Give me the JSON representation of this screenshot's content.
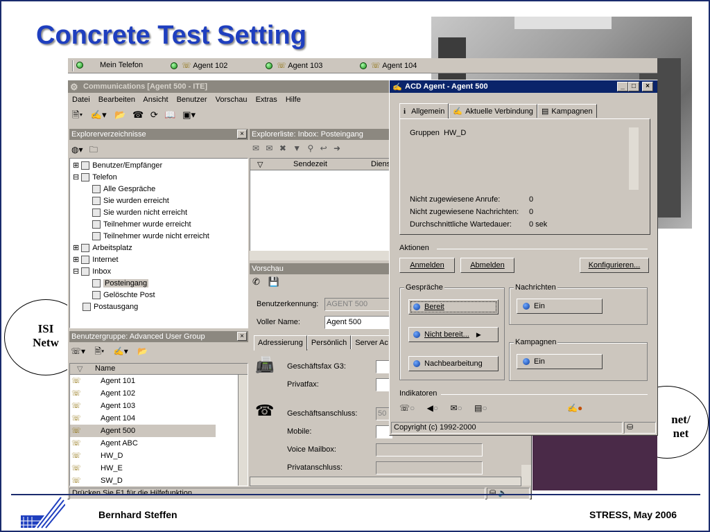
{
  "slide": {
    "title": "Concrete Test Setting",
    "footer_left": "Bernhard Steffen",
    "footer_right": "STRESS, May 2006",
    "cloud_left_line1": "ISI",
    "cloud_left_line2": "Netw",
    "cloud_right_line1": "net/",
    "cloud_right_line2": "net"
  },
  "top_toolbar": {
    "items": [
      "Mein Telefon",
      "Agent 102",
      "Agent 103",
      "Agent 104"
    ]
  },
  "communications": {
    "title": "Communications [Agent 500 - ITE]",
    "menu": [
      "Datei",
      "Bearbeiten",
      "Ansicht",
      "Benutzer",
      "Vorschau",
      "Extras",
      "Hilfe"
    ],
    "explorer_head": "Explorerverzeichnisse",
    "tree": [
      {
        "label": "Benutzer/Empfänger",
        "indent": 0
      },
      {
        "label": "Telefon",
        "indent": 0
      },
      {
        "label": "Alle Gespräche",
        "indent": 2
      },
      {
        "label": "Sie wurden erreicht",
        "indent": 2
      },
      {
        "label": "Sie wurden nicht erreicht",
        "indent": 2
      },
      {
        "label": "Teilnehmer wurde erreicht",
        "indent": 2
      },
      {
        "label": "Teilnehmer wurde nicht erreicht",
        "indent": 2
      },
      {
        "label": "Arbeitsplatz",
        "indent": 0
      },
      {
        "label": "Internet",
        "indent": 0
      },
      {
        "label": "Inbox",
        "indent": 0
      },
      {
        "label": "Posteingang",
        "indent": 2
      },
      {
        "label": "Gelöschte Post",
        "indent": 2
      },
      {
        "label": "Postausgang",
        "indent": 1
      }
    ],
    "list_head": "Explorerliste: Inbox: Posteingang",
    "list_columns": [
      "Sendezeit",
      "Diens"
    ],
    "preview_head": "Vorschau",
    "user_id_label": "Benutzerkennung:",
    "user_id_value": "AGENT 500",
    "full_name_label": "Voller Name:",
    "full_name_value": "Agent 500",
    "tabs": [
      "Adressierung",
      "Persönlich",
      "Server Ac"
    ],
    "fields": [
      "Geschäftsfax G3:",
      "Privatfax:",
      "Geschäftsanschluss:",
      "Mobile:",
      "Voice Mailbox:",
      "Privatanschluss:"
    ],
    "field_value_business": "50",
    "group_head": "Benutzergruppe: Advanced User Group",
    "group_column": "Name",
    "group_members": [
      "Agent 101",
      "Agent 102",
      "Agent 103",
      "Agent 104",
      "Agent 500",
      "Agent ABC",
      "HW_D",
      "HW_E",
      "SW_D"
    ],
    "status_text": "Drücken Sie F1 für die Hilfefunktion"
  },
  "acd": {
    "title": "ACD Agent - Agent 500",
    "tabs": [
      "Allgemein",
      "Aktuelle Verbindung",
      "Kampagnen"
    ],
    "groups_label": "Gruppen",
    "groups_value": "HW_D",
    "unassigned_calls_label": "Nicht zugewiesene Anrufe:",
    "unassigned_calls_value": "0",
    "unassigned_msgs_label": "Nicht zugewiesene Nachrichten:",
    "unassigned_msgs_value": "0",
    "avg_wait_label": "Durchschnittliche Wartedauer:",
    "avg_wait_value": "0 sek",
    "actions_label": "Aktionen",
    "login_button": "Anmelden",
    "logout_button": "Abmelden",
    "configure_button": "Konfigurieren...",
    "calls_group": "Gespräche",
    "ready_button": "Bereit",
    "not_ready_button": "Nicht bereit...",
    "wrapup_button": "Nachbearbeitung",
    "messages_group": "Nachrichten",
    "messages_button": "Ein",
    "campaigns_group": "Kampagnen",
    "campaigns_button": "Ein",
    "indicators_label": "Indikatoren",
    "copyright": "Copyright (c) 1992-2000"
  }
}
